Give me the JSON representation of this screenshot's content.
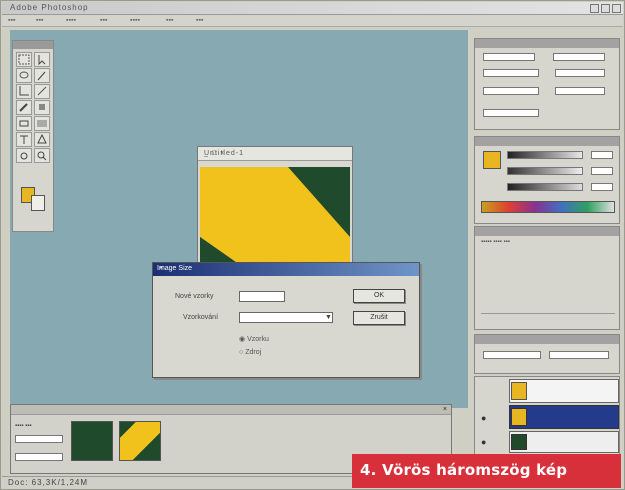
{
  "window": {
    "title": "Adobe Photoshop"
  },
  "dialog": {
    "title": "Image Size",
    "field1_label": "Nové vzorky",
    "field2_label": "Vzorkování",
    "ok_label": "OK",
    "cancel_label": "Zrušit",
    "radio1": "Vzorku",
    "radio2": "Zdroj"
  },
  "image_window": {
    "title": "Untitled-1",
    "buttons": "_ □ ×"
  },
  "statusbar": {
    "text": "Doc: 63,3K/1,24M"
  },
  "caption": {
    "text": "4. Vörös háromszög kép"
  },
  "colors": {
    "workspace": "#87aab2",
    "image_yellow": "#f2c21c",
    "image_green": "#1f4a2c",
    "dialog_title_start": "#1b2f72",
    "caption_bg": "#d8303a"
  }
}
